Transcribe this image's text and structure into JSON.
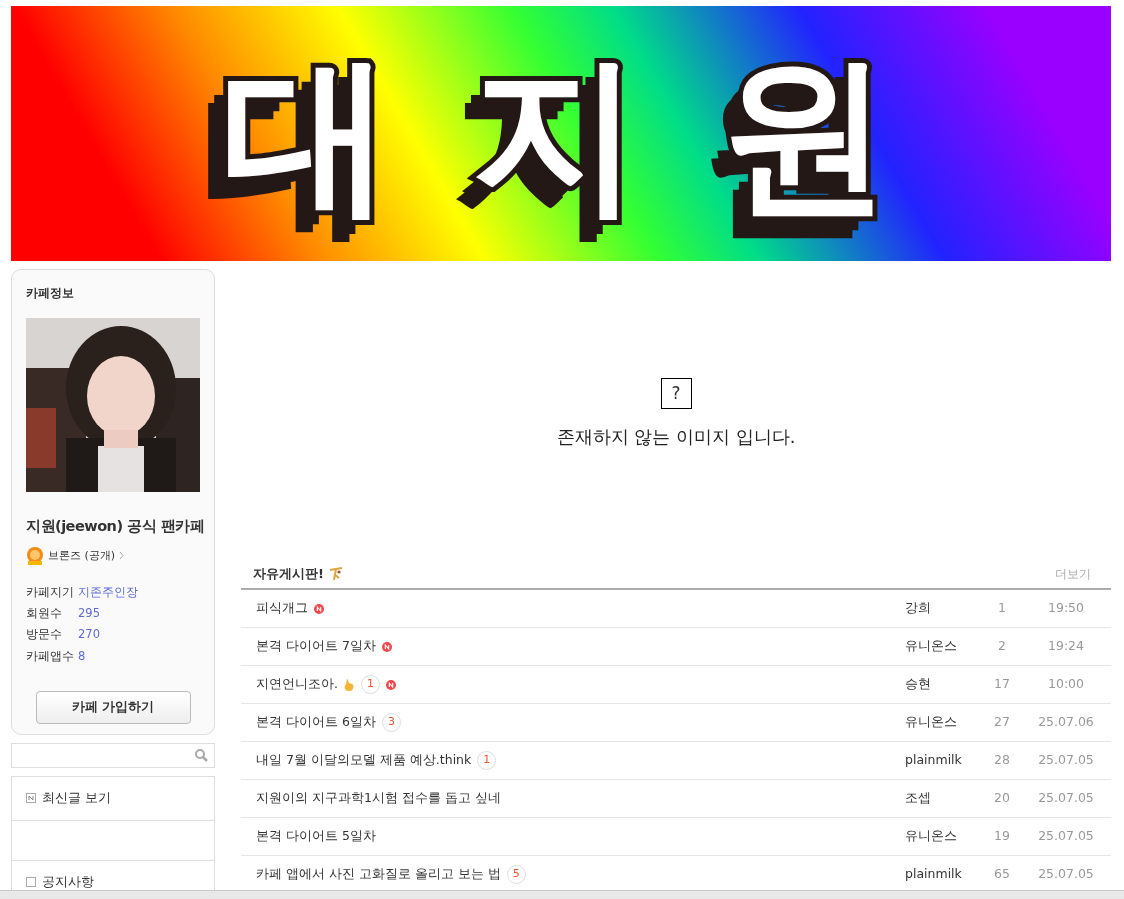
{
  "banner": {
    "title": "대 지 원"
  },
  "sidebar": {
    "heading": "카페정보",
    "cafe_name": "지원(jeewon) 공식 팬카페",
    "grade": "브론즈",
    "grade_note": "(공개)",
    "stats": [
      {
        "label": "카페지기",
        "value": "지존주인장"
      },
      {
        "label": "회원수",
        "value": "295"
      },
      {
        "label": "방문수",
        "value": "270"
      },
      {
        "label": "카페앱수",
        "value": "8"
      }
    ],
    "join_button": "카페 가입하기",
    "menu": [
      {
        "kind": "new",
        "label": "최신글 보기"
      },
      {
        "kind": "blank"
      },
      {
        "kind": "notice",
        "label": "공지사항"
      }
    ]
  },
  "missing_image": {
    "mark": "?",
    "message": "존재하지 않는 이미지 입니다."
  },
  "board": {
    "title": "자유게시판!",
    "more": "더보기",
    "rows": [
      {
        "title": "피식개그",
        "comments": null,
        "hand": false,
        "new": true,
        "author": "강희",
        "views": "1",
        "date": "19:50"
      },
      {
        "title": "본격 다이어트 7일차",
        "comments": null,
        "hand": false,
        "new": true,
        "author": "유니온스",
        "views": "2",
        "date": "19:24"
      },
      {
        "title": "지연언니조아.",
        "comments": "1",
        "hand": true,
        "new": true,
        "author": "승현",
        "views": "17",
        "date": "10:00"
      },
      {
        "title": "본격 다이어트 6일차",
        "comments": "3",
        "hand": false,
        "new": false,
        "author": "유니온스",
        "views": "27",
        "date": "25.07.06"
      },
      {
        "title": "내일 7월 이달의모델 제품 예상.think",
        "comments": "1",
        "hand": false,
        "new": false,
        "author": "plainmilk",
        "views": "28",
        "date": "25.07.05"
      },
      {
        "title": "지원이의 지구과학1시험 접수를 돕고 싶네",
        "comments": null,
        "hand": false,
        "new": false,
        "author": "조셉",
        "views": "20",
        "date": "25.07.05"
      },
      {
        "title": "본격 다이어트 5일차",
        "comments": null,
        "hand": false,
        "new": false,
        "author": "유니온스",
        "views": "19",
        "date": "25.07.05"
      },
      {
        "title": "카페 앱에서 사진 고화질로 올리고 보는 법",
        "comments": "5",
        "hand": false,
        "new": false,
        "author": "plainmilk",
        "views": "65",
        "date": "25.07.05"
      }
    ]
  }
}
